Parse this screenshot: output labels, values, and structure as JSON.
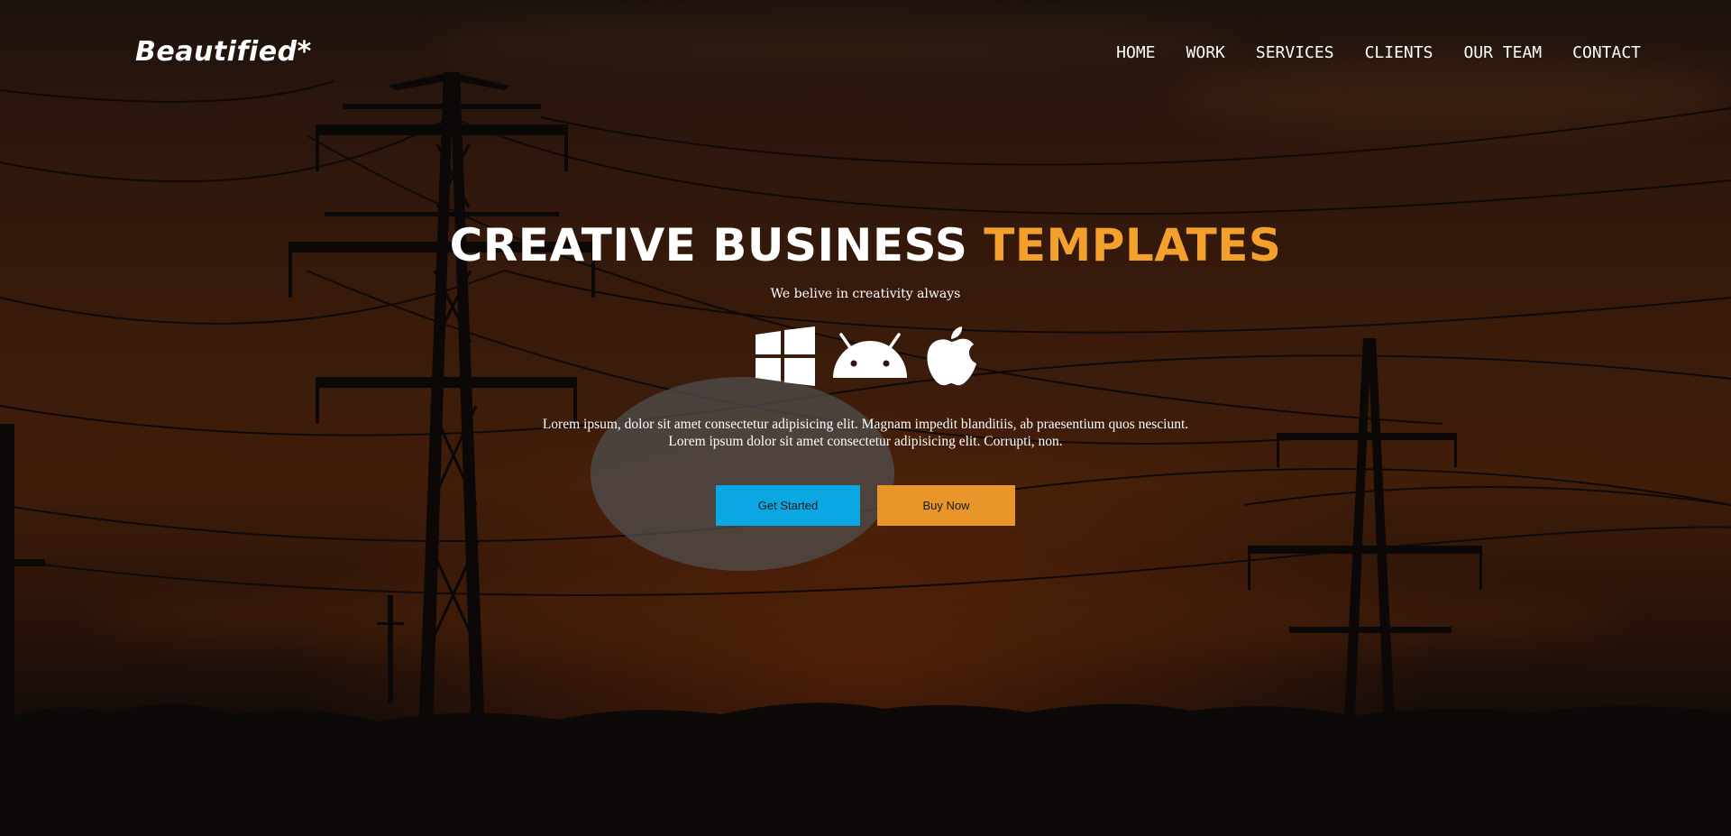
{
  "brand": {
    "logo_text": "Beautified*"
  },
  "nav": {
    "items": [
      {
        "label": "HOME"
      },
      {
        "label": "WORK"
      },
      {
        "label": "SERVICES"
      },
      {
        "label": "CLIENTS"
      },
      {
        "label": "OUR TEAM"
      },
      {
        "label": "CONTACT"
      }
    ]
  },
  "hero": {
    "headline_white": "CREATIVE BUSINESS",
    "headline_orange": "TEMPLATES",
    "subtitle": "We belive in creativity always",
    "platform_icons": [
      "windows-icon",
      "android-icon",
      "apple-icon"
    ],
    "body_line_1": "Lorem ipsum, dolor sit amet consectetur adipisicing elit. Magnam impedit blanditiis, ab praesentium quos nesciunt.",
    "body_line_2": "Lorem ipsum dolor sit amet consectetur adipisicing elit. Corrupti, non.",
    "primary_button": "Get Started",
    "secondary_button": "Buy Now"
  },
  "colors": {
    "accent_orange": "#f3a02c",
    "button_primary": "#0aa7e2",
    "button_secondary": "#e8952a"
  }
}
